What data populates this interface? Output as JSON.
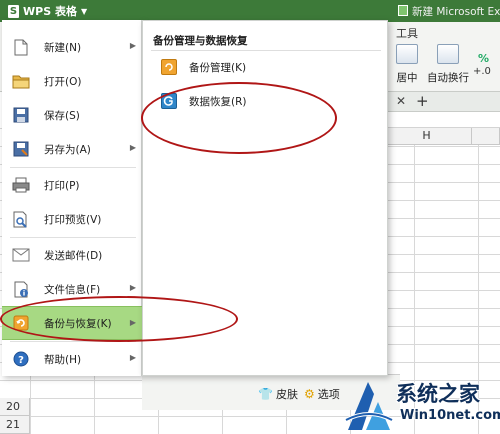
{
  "app": {
    "menu_button": "WPS 表格",
    "doc_title": "新建 Microsoft Exce"
  },
  "ribbon": {
    "tools_tab": "工具",
    "center_label": "居中",
    "wrap_label": "自动换行",
    "pct_symbol": "%",
    "small_label": "+.0"
  },
  "sheet": {
    "column_H": "H",
    "row_20": "20",
    "row_21": "21"
  },
  "file_menu": {
    "items": [
      {
        "label": "新建(N)",
        "icon": "new-doc-icon",
        "has_submenu": true
      },
      {
        "label": "打开(O)",
        "icon": "open-folder-icon",
        "has_submenu": false
      },
      {
        "label": "保存(S)",
        "icon": "save-icon",
        "has_submenu": false
      },
      {
        "label": "另存为(A)",
        "icon": "save-as-icon",
        "has_submenu": true
      },
      {
        "label": "打印(P)",
        "icon": "print-icon",
        "has_submenu": false
      },
      {
        "label": "打印预览(V)",
        "icon": "print-preview-icon",
        "has_submenu": false
      },
      {
        "label": "发送邮件(D)",
        "icon": "mail-icon",
        "has_submenu": false
      },
      {
        "label": "文件信息(F)",
        "icon": "file-info-icon",
        "has_submenu": true
      },
      {
        "label": "备份与恢复(K)",
        "icon": "backup-icon",
        "has_submenu": true,
        "active": true
      },
      {
        "label": "帮助(H)",
        "icon": "help-icon",
        "has_submenu": true
      }
    ]
  },
  "submenu": {
    "title": "备份管理与数据恢复",
    "items": [
      {
        "label": "备份管理(K)",
        "icon": "backup-manage-icon"
      },
      {
        "label": "数据恢复(R)",
        "icon": "data-recovery-icon"
      }
    ]
  },
  "footer": {
    "skin": "皮肤",
    "options": "选项"
  },
  "watermark": {
    "title": "系统之家",
    "site": "Win10net.com"
  },
  "colors": {
    "titlebar": "#3d7a39",
    "active_item": "#a7d983",
    "annotation": "#b01616"
  }
}
